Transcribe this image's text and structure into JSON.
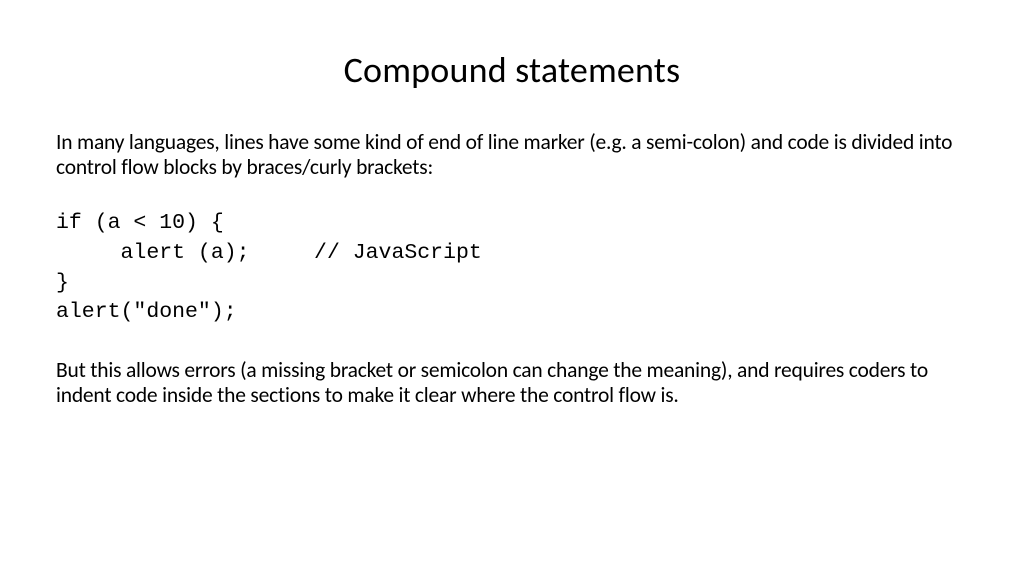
{
  "slide": {
    "title": "Compound statements",
    "intro": "In many languages, lines have some kind of end of line marker (e.g. a semi-colon) and code is divided into control flow blocks by braces/curly brackets:",
    "code": "if (a < 10) {\n     alert (a);     // JavaScript\n}\nalert(\"done\");",
    "closing": "But this allows errors (a missing bracket or semicolon can change the meaning), and requires coders to indent code inside the sections to make it clear where the control flow is."
  }
}
